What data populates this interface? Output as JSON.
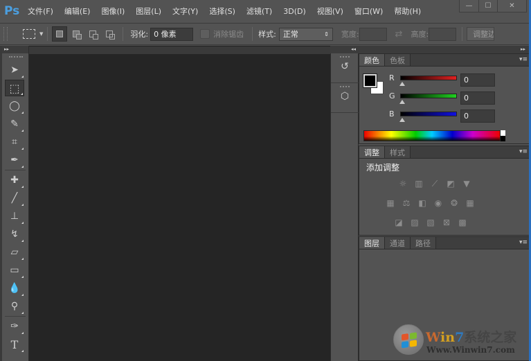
{
  "app": {
    "logo": "Ps"
  },
  "menu": [
    "文件(F)",
    "编辑(E)",
    "图像(I)",
    "图层(L)",
    "文字(Y)",
    "选择(S)",
    "滤镜(T)",
    "3D(D)",
    "视图(V)",
    "窗口(W)",
    "帮助(H)"
  ],
  "window_controls": {
    "minimize": "—",
    "maximize": "☐",
    "close": "✕"
  },
  "options": {
    "feather_label": "羽化:",
    "feather_value": "0 像素",
    "antialias_label": "消除锯齿",
    "style_label": "样式:",
    "style_value": "正常",
    "width_label": "宽度:",
    "height_label": "高度:",
    "swap_icon": "⇄",
    "refine_label": "调整边缘..."
  },
  "toolbox": {
    "collapse": "▸▸",
    "tools": [
      {
        "name": "move-tool",
        "glyph": "➤"
      },
      {
        "name": "marquee-tool",
        "glyph": "⬚",
        "active": true
      },
      {
        "name": "lasso-tool",
        "glyph": "◯"
      },
      {
        "name": "quick-selection-tool",
        "glyph": "✎"
      },
      {
        "name": "crop-tool",
        "glyph": "⌗"
      },
      {
        "name": "eyedropper-tool",
        "glyph": "✒"
      },
      {
        "name": "healing-brush-tool",
        "glyph": "✚"
      },
      {
        "name": "brush-tool",
        "glyph": "╱"
      },
      {
        "name": "clone-stamp-tool",
        "glyph": "⊥"
      },
      {
        "name": "history-brush-tool",
        "glyph": "↯"
      },
      {
        "name": "eraser-tool",
        "glyph": "▱"
      },
      {
        "name": "gradient-tool",
        "glyph": "▭"
      },
      {
        "name": "blur-tool",
        "glyph": "💧"
      },
      {
        "name": "dodge-tool",
        "glyph": "⚲"
      },
      {
        "name": "pen-tool",
        "glyph": "✑"
      },
      {
        "name": "type-tool",
        "glyph": "T"
      }
    ]
  },
  "dock": {
    "collapse_left": "◂◂",
    "expand_right": "▸▸",
    "buttons": [
      {
        "name": "history",
        "glyph": "↺"
      },
      {
        "name": "3d",
        "glyph": "⬡"
      }
    ]
  },
  "color_panel": {
    "tabs": [
      "颜色",
      "色板"
    ],
    "active_tab": 0,
    "menu_icon": "▾≡",
    "foreground": "#000000",
    "background": "#ffffff",
    "channels": [
      {
        "label": "R",
        "value": "0",
        "color": "#e02020"
      },
      {
        "label": "G",
        "value": "0",
        "color": "#20d020"
      },
      {
        "label": "B",
        "value": "0",
        "color": "#1010e0"
      }
    ]
  },
  "adjustments_panel": {
    "tabs": [
      "调整",
      "样式"
    ],
    "active_tab": 0,
    "menu_icon": "▾≡",
    "title": "添加调整",
    "rows": [
      [
        "brightness-contrast",
        "levels",
        "curves",
        "exposure",
        "vibrance"
      ],
      [
        "hue-saturation",
        "color-balance",
        "black-white",
        "photo-filter",
        "channel-mixer",
        "color-lookup"
      ],
      [
        "invert",
        "posterize",
        "threshold",
        "selective-color",
        "gradient-map"
      ]
    ]
  },
  "layers_panel": {
    "tabs": [
      "图层",
      "通道",
      "路径"
    ],
    "active_tab": 0,
    "menu_icon": "▾≡"
  },
  "watermark": {
    "title_w": "W",
    "title_in": "in",
    "title_7": "7",
    "title_cn": "系统之家",
    "url": "Www.Winwin7.com"
  }
}
